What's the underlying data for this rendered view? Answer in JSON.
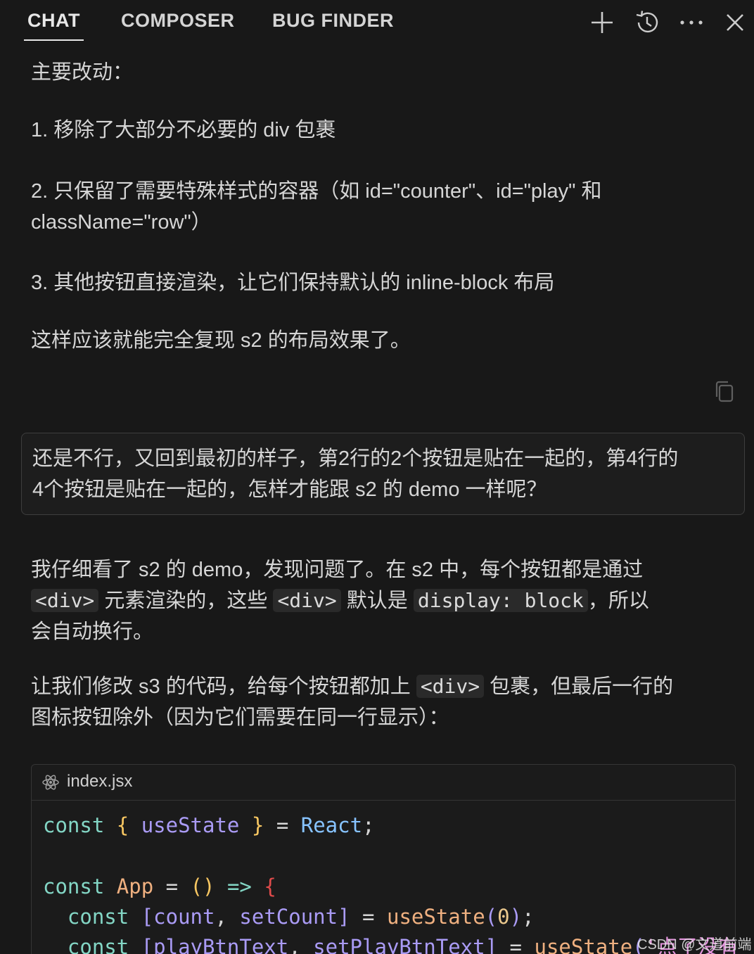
{
  "tabs": [
    {
      "label": "CHAT",
      "active": true
    },
    {
      "label": "COMPOSER",
      "active": false
    },
    {
      "label": "BUG FINDER",
      "active": false
    }
  ],
  "header_icons": [
    "plus-icon",
    "history-icon",
    "more-icon",
    "close-icon"
  ],
  "assistant_prev": {
    "heading": "主要改动：",
    "item1": "1. 移除了大部分不必要的 div 包裹",
    "item2_line1": "2. 只保留了需要特殊样式的容器（如 id=\"counter\"、id=\"play\" 和",
    "item2_line2": "className=\"row\"）",
    "item3": "3. 其他按钮直接渲染，让它们保持默认的 inline-block 布局",
    "closing": "这样应该就能完全复现 s2 的布局效果了。"
  },
  "user_message": {
    "line1": "还是不行，又回到最初的样子，第2行的2个按钮是贴在一起的，第4行的",
    "line2": "4个按钮是贴在一起的，怎样才能跟 s2 的 demo 一样呢？"
  },
  "assistant_reply": {
    "p1_line1": "我仔细看了 s2 的 demo，发现问题了。在 s2 中，每个按钮都是通过",
    "p1_code1": "<div>",
    "p1_mid1": "元素渲染的，这些",
    "p1_code2": "<div>",
    "p1_mid2": "默认是",
    "p1_code3": "display: block",
    "p1_end": "，所以",
    "p1_line3": "会自动换行。",
    "p2_start": "让我们修改 s3 的代码，给每个按钮都加上",
    "p2_code": "<div>",
    "p2_end": "包裹，但最后一行的",
    "p2_line2": "图标按钮除外（因为它们需要在同一行显示）："
  },
  "code_block": {
    "filename": "index.jsx",
    "l1": {
      "kw": "const",
      "b1": "{",
      "v": "useState",
      "b2": "}",
      "eq": "=",
      "cls": "React",
      "end": ";"
    },
    "l3": {
      "kw": "const",
      "name": "App",
      "eq": "=",
      "parens": "()",
      "arrow": "=>",
      "brace": "{"
    },
    "l4": {
      "kw": "const",
      "lb": "[",
      "v1": "count",
      "comma": ",",
      "v2": "setCount",
      "rb": "]",
      "eq": "=",
      "fn": "useState",
      "lp": "(",
      "num": "0",
      "rp": ")",
      "end": ";"
    },
    "l5": {
      "kw": "const",
      "lb": "[",
      "v1": "playBtnText",
      "comma": ",",
      "v2": "setPlayBtnText",
      "rb": "]",
      "eq": "=",
      "fn": "useState",
      "lp": "(",
      "str": "'点了没有"
    }
  },
  "watermark": "CSDN @文道前端",
  "colors": {
    "background": "#181818",
    "keyword": "#83d6c5",
    "variable": "#aa9bf5",
    "class": "#87c3ff",
    "function": "#efb080"
  }
}
